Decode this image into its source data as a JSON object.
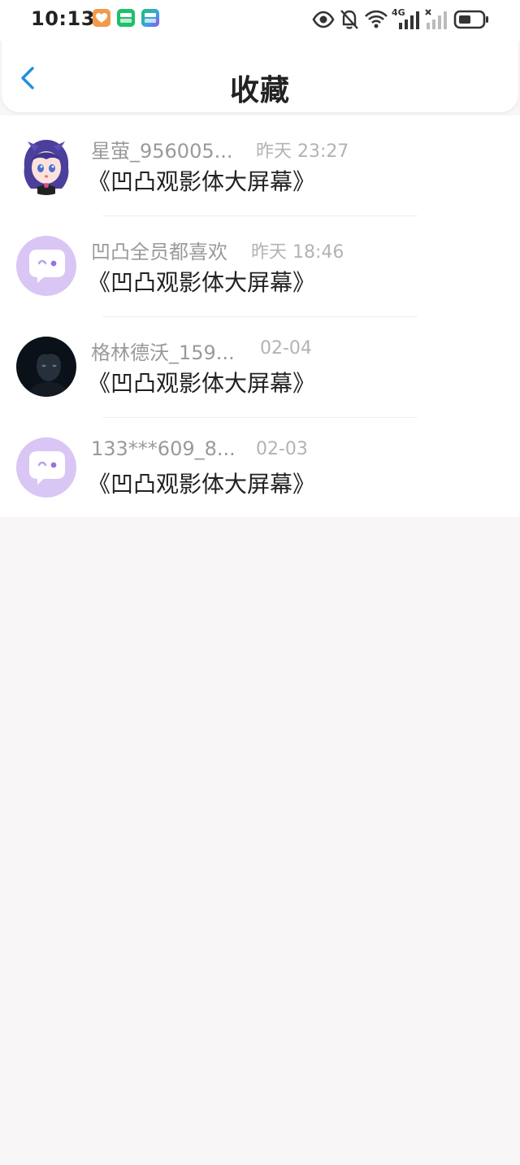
{
  "status_bar": {
    "time": "10:13",
    "network": "4G"
  },
  "header": {
    "title": "收藏"
  },
  "favorites": [
    {
      "user": "星萤_956005...",
      "time": "昨天 23:27",
      "content": "《凹凸观影体大屏幕》",
      "avatar": "anime-girl"
    },
    {
      "user": "凹凸全员都喜欢",
      "time": "昨天 18:46",
      "content": "《凹凸观影体大屏幕》",
      "avatar": "default-bubble"
    },
    {
      "user": "格林德沃_159...",
      "time": "02-04",
      "content": "《凹凸观影体大屏幕》",
      "avatar": "dark-portrait"
    },
    {
      "user": "133***609_8...",
      "time": "02-03",
      "content": "《凹凸观影体大屏幕》",
      "avatar": "default-bubble"
    }
  ],
  "colors": {
    "accent": "#1f8fe0",
    "default_avatar_bg": "#d9c6f5",
    "page_bg": "#f8f6f7"
  }
}
